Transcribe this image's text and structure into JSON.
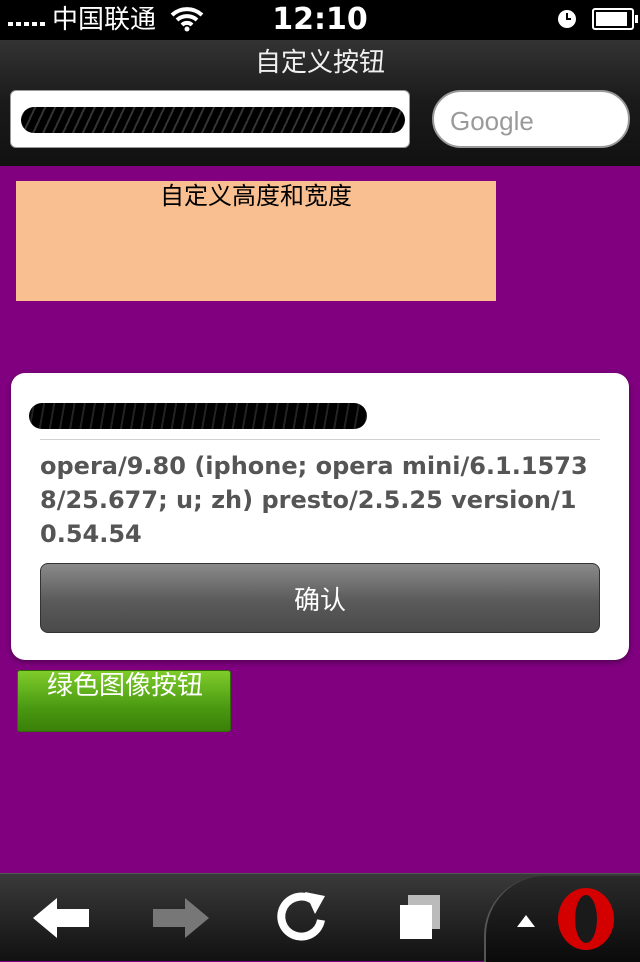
{
  "status_bar": {
    "carrier": "中国联通",
    "time": "12:10",
    "battery_level": 0.9,
    "icons": [
      "signal-icon",
      "wifi-icon",
      "alarm-clock-icon",
      "battery-icon"
    ]
  },
  "header": {
    "title": "自定义按钮",
    "url_value": "",
    "search_placeholder": "Google"
  },
  "main": {
    "custom_size_button_label": "自定义高度和宽度",
    "card": {
      "user_agent_text": "opera/9.80 (iphone; opera mini/6.1.15738/25.677; u; zh) presto/2.5.25 version/10.54.54",
      "confirm_label": "确认"
    },
    "green_button_label": "绿色图像按钮"
  },
  "toolbar": {
    "icons": [
      "back-arrow-icon",
      "forward-arrow-icon",
      "reload-icon",
      "tabs-icon",
      "menu-up-arrow-icon",
      "opera-logo-icon"
    ]
  },
  "colors": {
    "page_background": "#800080",
    "custom_box": "#f9bf90",
    "green_button": "#4b9a12",
    "opera_red": "#d40000"
  }
}
